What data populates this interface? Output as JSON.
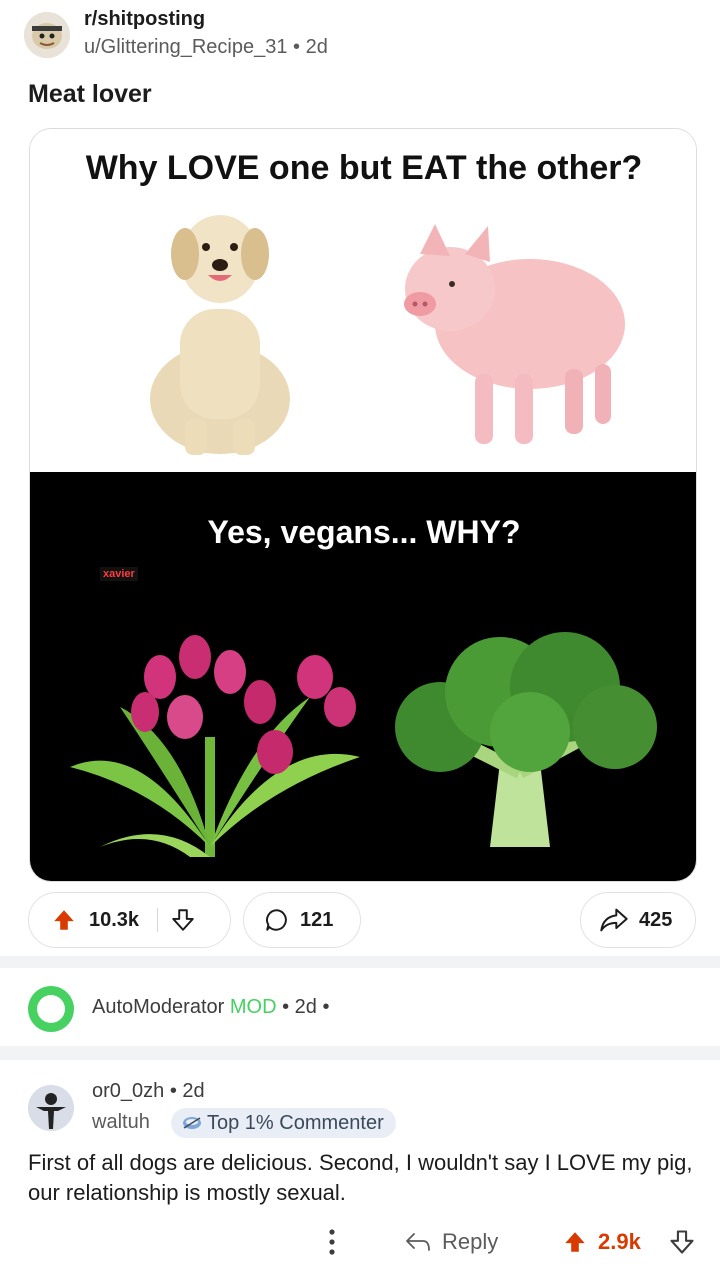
{
  "post": {
    "subreddit": "r/shitposting",
    "author": "u/Glittering_Recipe_31",
    "age": "2d",
    "title": "Meat lover",
    "image": {
      "question_top": "Why LOVE one but EAT the other?",
      "question_bottom": "Yes, vegans... WHY?",
      "watermark": "xavier"
    },
    "votes": "10.3k",
    "comments": "121",
    "shares": "425"
  },
  "automod": {
    "name": "AutoModerator",
    "badge": "MOD",
    "age": "2d"
  },
  "comment": {
    "author": "or0_0zh",
    "age": "2d",
    "user_flair": "waltuh",
    "achievement": "Top 1% Commenter",
    "body": "First of all dogs are delicious. Second, I wouldn't say I LOVE my pig, our relationship is mostly sexual.",
    "reply_label": "Reply",
    "votes": "2.9k"
  },
  "colors": {
    "upvote": "#d93a00",
    "mod_green": "#46d160"
  }
}
